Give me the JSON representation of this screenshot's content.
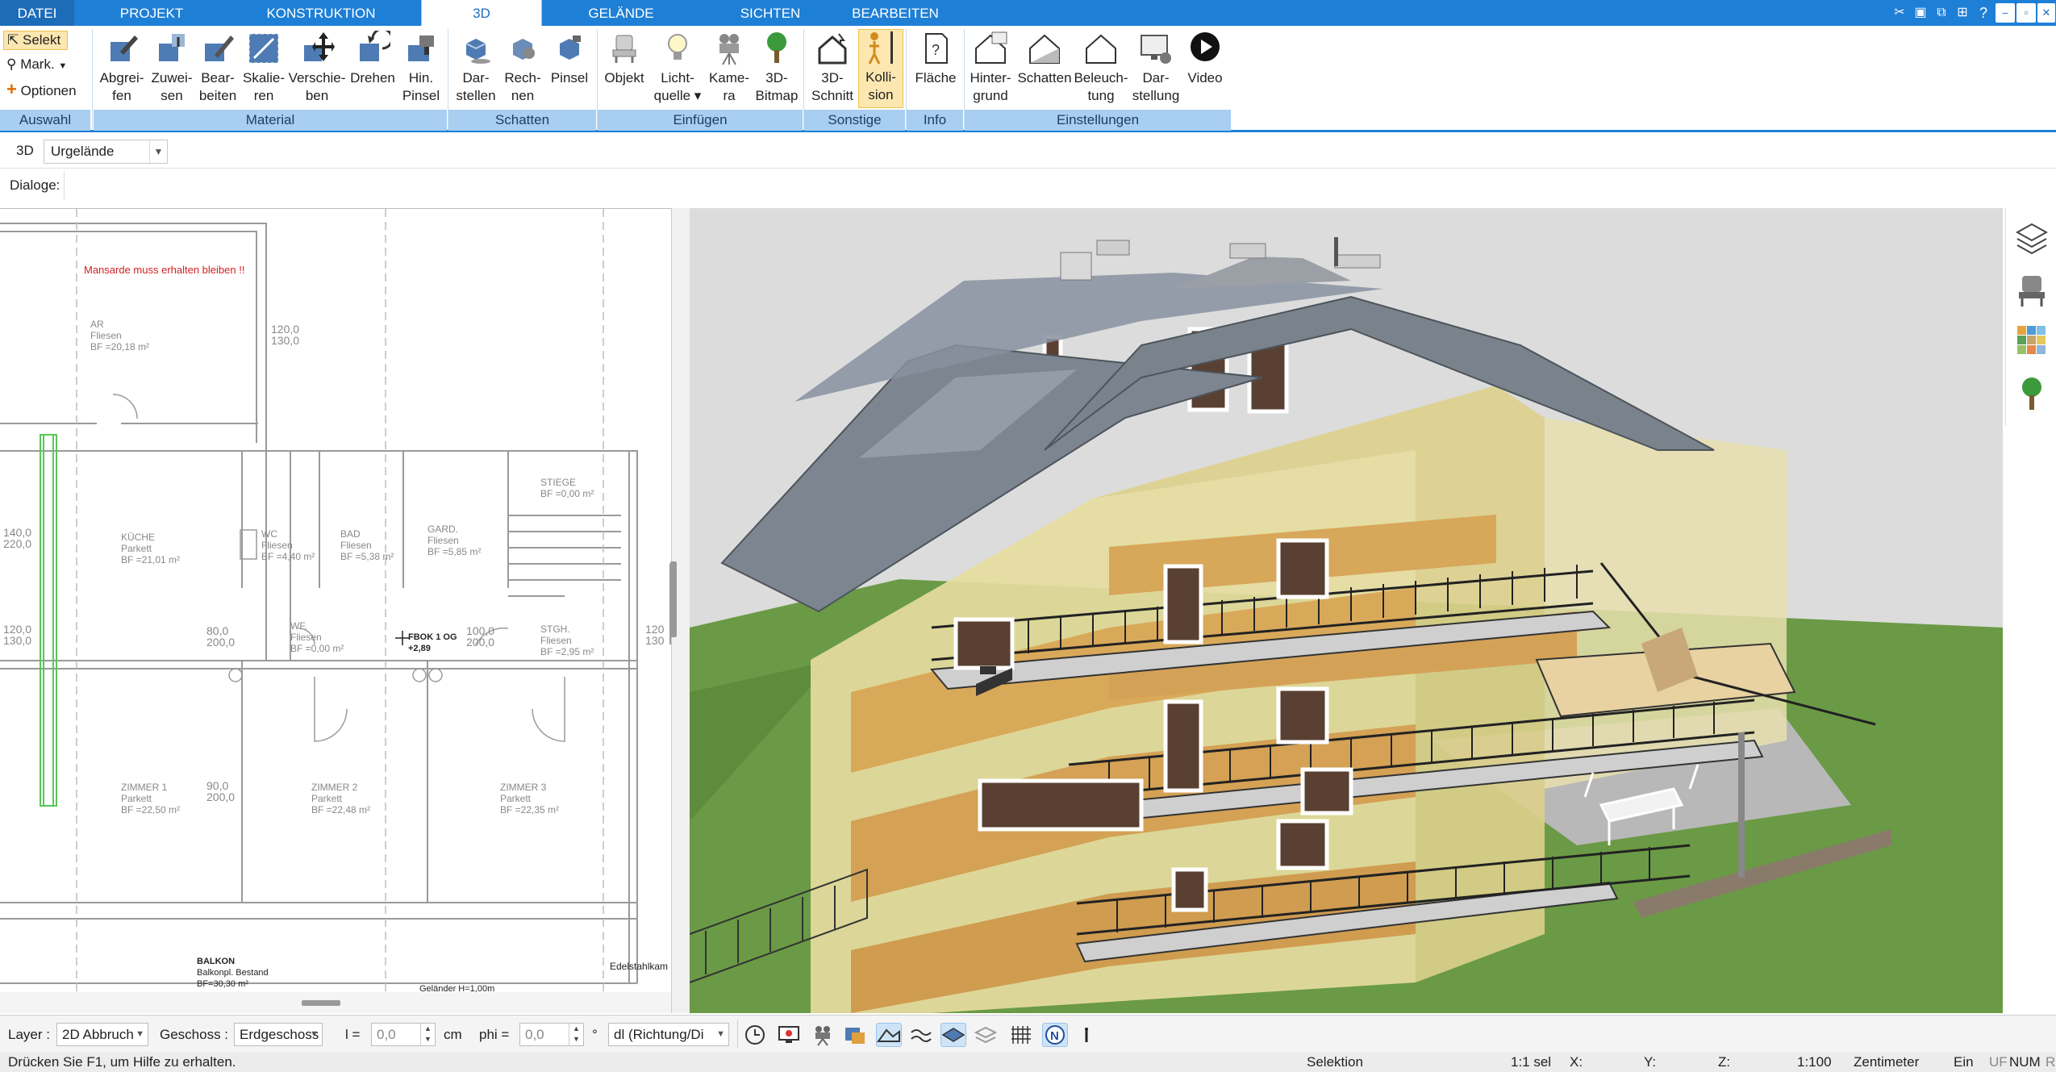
{
  "menu": {
    "tabs": [
      {
        "label": "DATEI",
        "active": false
      },
      {
        "label": "PROJEKT",
        "active": false
      },
      {
        "label": "KONSTRUKTION",
        "active": false
      },
      {
        "label": "3D",
        "active": true
      },
      {
        "label": "GELÄNDE",
        "active": false
      },
      {
        "label": "SICHTEN",
        "active": false
      },
      {
        "label": "BEARBEITEN",
        "active": false
      }
    ],
    "window_buttons": [
      "–",
      "▫",
      "✕"
    ]
  },
  "ribbon": {
    "auswahl": {
      "select": "Selekt",
      "mark": "Mark.",
      "options": "Optionen",
      "group": "Auswahl"
    },
    "material": {
      "group": "Material",
      "buttons": [
        {
          "l1": "Abgrei-",
          "l2": "fen"
        },
        {
          "l1": "Zuwei-",
          "l2": "sen"
        },
        {
          "l1": "Bear-",
          "l2": "beiten"
        },
        {
          "l1": "Skalie-",
          "l2": "ren"
        },
        {
          "l1": "Verschie-",
          "l2": "ben"
        },
        {
          "l1": "Drehen",
          "l2": ""
        },
        {
          "l1": "Hin.",
          "l2": "Pinsel"
        }
      ]
    },
    "schatten": {
      "group": "Schatten",
      "buttons": [
        {
          "l1": "Dar-",
          "l2": "stellen"
        },
        {
          "l1": "Rech-",
          "l2": "nen"
        },
        {
          "l1": "Pinsel",
          "l2": ""
        }
      ]
    },
    "einfuegen": {
      "group": "Einfügen",
      "buttons": [
        {
          "l1": "Objekt",
          "l2": ""
        },
        {
          "l1": "Licht-",
          "l2": "quelle ▾"
        },
        {
          "l1": "Kame-",
          "l2": "ra"
        },
        {
          "l1": "3D-",
          "l2": "Bitmap"
        }
      ]
    },
    "sonstige": {
      "group": "Sonstige",
      "buttons": [
        {
          "l1": "3D-",
          "l2": "Schnitt"
        },
        {
          "l1": "Kolli-",
          "l2": "sion"
        }
      ]
    },
    "info": {
      "group": "Info",
      "buttons": [
        {
          "l1": "Fläche",
          "l2": ""
        }
      ]
    },
    "einstellungen": {
      "group": "Einstellungen",
      "buttons": [
        {
          "l1": "Hinter-",
          "l2": "grund"
        },
        {
          "l1": "Schatten",
          "l2": ""
        },
        {
          "l1": "Beleuch-",
          "l2": "tung"
        },
        {
          "l1": "Dar-",
          "l2": "stellung"
        },
        {
          "l1": "Video",
          "l2": ""
        }
      ]
    }
  },
  "subtoolbar": {
    "mode": "3D",
    "terrain": "Urgelände",
    "dialogs_label": "Dialoge:"
  },
  "plan": {
    "warning": "Mansarde muss erhalten bleiben !!",
    "rooms": [
      {
        "name": "AR",
        "floor": "Fliesen",
        "area": "BF =20,18 m²"
      },
      {
        "name": "KÜCHE",
        "floor": "Parkett",
        "area": "BF =21,01 m²"
      },
      {
        "name": "WC",
        "floor": "Fliesen",
        "area": "BF =4,40 m²"
      },
      {
        "name": "BAD",
        "floor": "Fliesen",
        "area": "BF =5,38 m²"
      },
      {
        "name": "GARD.",
        "floor": "Fliesen",
        "area": "BF =5,85 m²"
      },
      {
        "name": "STIEGE",
        "floor": "",
        "area": "BF =0,00 m²"
      },
      {
        "name": "WF.",
        "floor": "Fliesen",
        "area": "BF =0,00 m²"
      },
      {
        "name": "STGH.",
        "floor": "Fliesen",
        "area": "BF =2,95 m²"
      },
      {
        "name": "ZIMMER 1",
        "floor": "Parkett",
        "area": "BF =22,50 m²"
      },
      {
        "name": "ZIMMER 2",
        "floor": "Parkett",
        "area": "BF =22,48 m²"
      },
      {
        "name": "ZIMMER 3",
        "floor": "Parkett",
        "area": "BF =22,35 m²"
      }
    ],
    "balcony": {
      "name": "BALKON",
      "sub": "Balkonpl. Bestand",
      "area": "BF=30,30 m²"
    },
    "railing": "Geländer H=1,00m",
    "steel": "Edelstahlkam",
    "level_marker": "FBOK 1 OG",
    "level_value": "+2,89",
    "dims": [
      "120,0",
      "130,0",
      "80,0",
      "200,0",
      "140,0",
      "220,0",
      "120,0",
      "130,0",
      "100,0",
      "200,0",
      "90,0",
      "140,0",
      "200,0",
      "100,0",
      "120",
      "130"
    ]
  },
  "bottombar": {
    "layer_label": "Layer :",
    "layer_value": "2D Abbruch",
    "floor_label": "Geschoss :",
    "floor_value": "Erdgeschoss",
    "l_label": "l =",
    "l_value": "0,0",
    "l_unit": "cm",
    "phi_label": "phi =",
    "phi_value": "0,0",
    "phi_unit": "°",
    "direction": "dl (Richtung/Di"
  },
  "status": {
    "help": "Drücken Sie F1, um Hilfe zu erhalten.",
    "mode": "Selektion",
    "scale_sel": "1:1 sel",
    "x": "X:",
    "y": "Y:",
    "z": "Z:",
    "scale": "1:100",
    "unit": "Zentimeter",
    "ein": "Ein",
    "uf": "UF",
    "num": "NUM",
    "r": "R"
  },
  "colors": {
    "accent": "#1e7fd6",
    "group_bar": "#a8cff2",
    "active_tool": "#fce7b0",
    "grass": "#6a9a45",
    "wall": "#e6dca0",
    "roof": "#7d8690"
  }
}
